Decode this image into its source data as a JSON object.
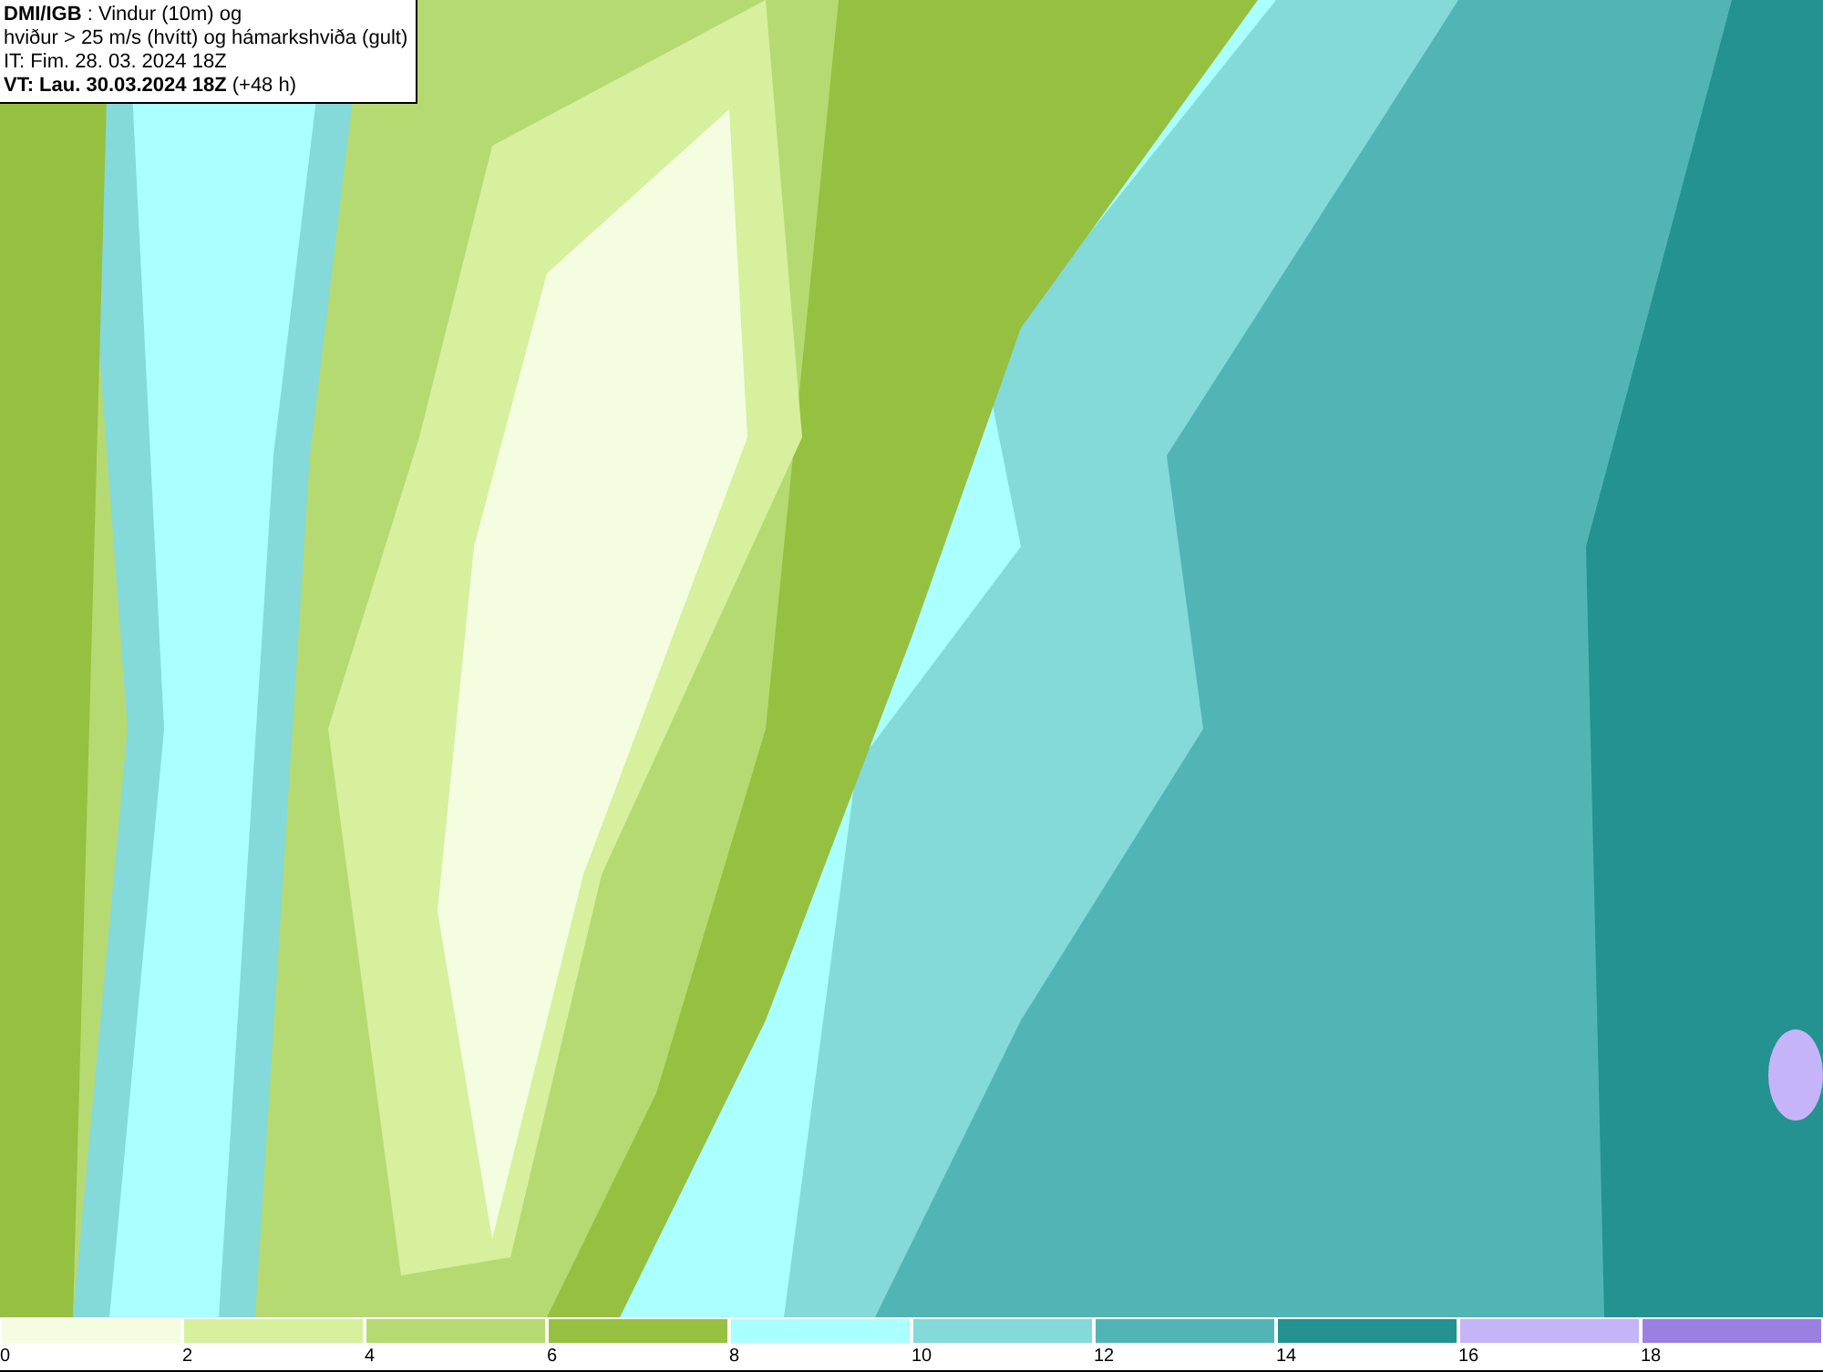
{
  "title_box": {
    "lines": [
      "**DMI/IGB** : Vindur (10m) og",
      "hviður > 25 m/s (hvítt) og hámarkshviða (gult)",
      "IT: Fim. 28. 03. 2024 18Z",
      "**VT: Lau. 30.03.2024 18Z** (+48 h)"
    ]
  },
  "legend": {
    "swatches": [
      {
        "color": "#f4fde0"
      },
      {
        "color": "#d6f09e"
      },
      {
        "color": "#b6da72"
      },
      {
        "color": "#96c040"
      },
      {
        "color": "#aaffff"
      },
      {
        "color": "#84d9d9"
      },
      {
        "color": "#52b5b5"
      },
      {
        "color": "#249290"
      },
      {
        "color": "#c6b4f8"
      },
      {
        "color": "#9a80e0"
      }
    ],
    "labels": [
      "0",
      "2",
      "4",
      "6",
      "8",
      "10",
      "12",
      "14",
      "16",
      "18"
    ]
  }
}
